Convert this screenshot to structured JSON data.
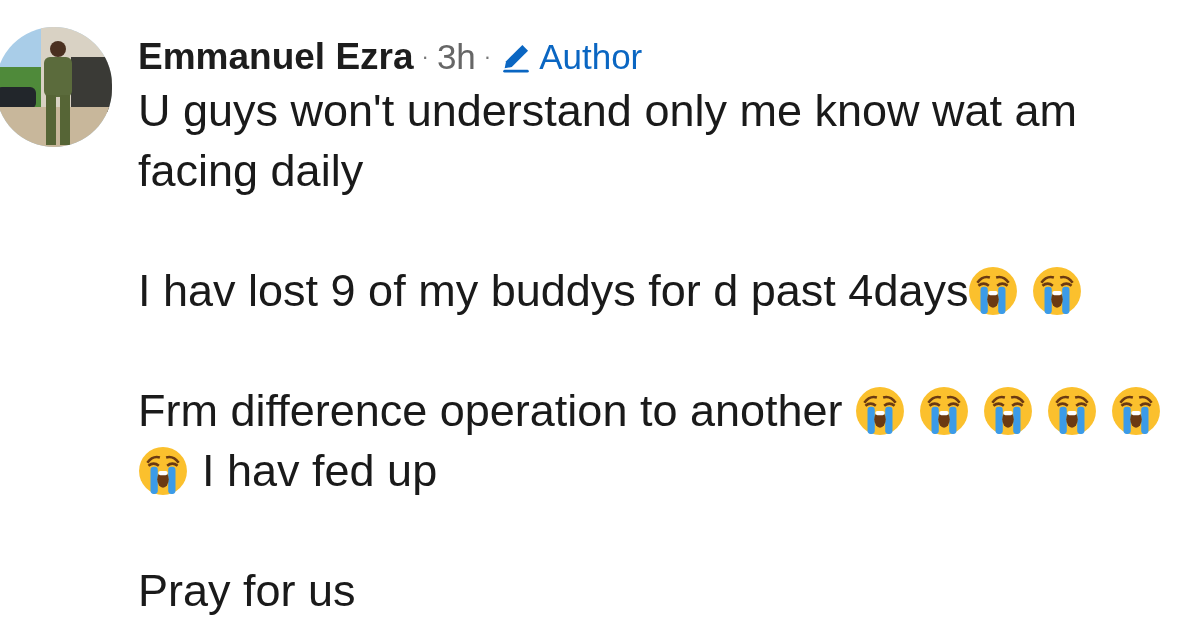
{
  "comment": {
    "author": "Emmanuel Ezra",
    "separator_1": "·",
    "time": "3h",
    "separator_2": "·",
    "badge": "Author",
    "paragraphs": [
      {
        "lines": [
          [
            {
              "kind": "text",
              "text": "U guys won't understand only me know wat am"
            }
          ],
          [
            {
              "kind": "text",
              "text": "facing daily"
            }
          ]
        ]
      },
      {
        "lines": [
          [
            {
              "kind": "text",
              "text": "I hav lost 9 of my buddys for d past 4days"
            },
            {
              "kind": "emoji"
            },
            {
              "kind": "emoji"
            }
          ]
        ]
      },
      {
        "lines": [
          [
            {
              "kind": "text",
              "text": "Frm difference operation to another "
            },
            {
              "kind": "emoji"
            },
            {
              "kind": "emoji"
            },
            {
              "kind": "emoji"
            },
            {
              "kind": "emoji"
            },
            {
              "kind": "emoji"
            }
          ],
          [
            {
              "kind": "emoji"
            },
            {
              "kind": "text",
              "text": "I hav fed up"
            }
          ]
        ]
      },
      {
        "lines": [
          [
            {
              "kind": "text",
              "text": "Pray for us"
            }
          ]
        ]
      }
    ]
  }
}
